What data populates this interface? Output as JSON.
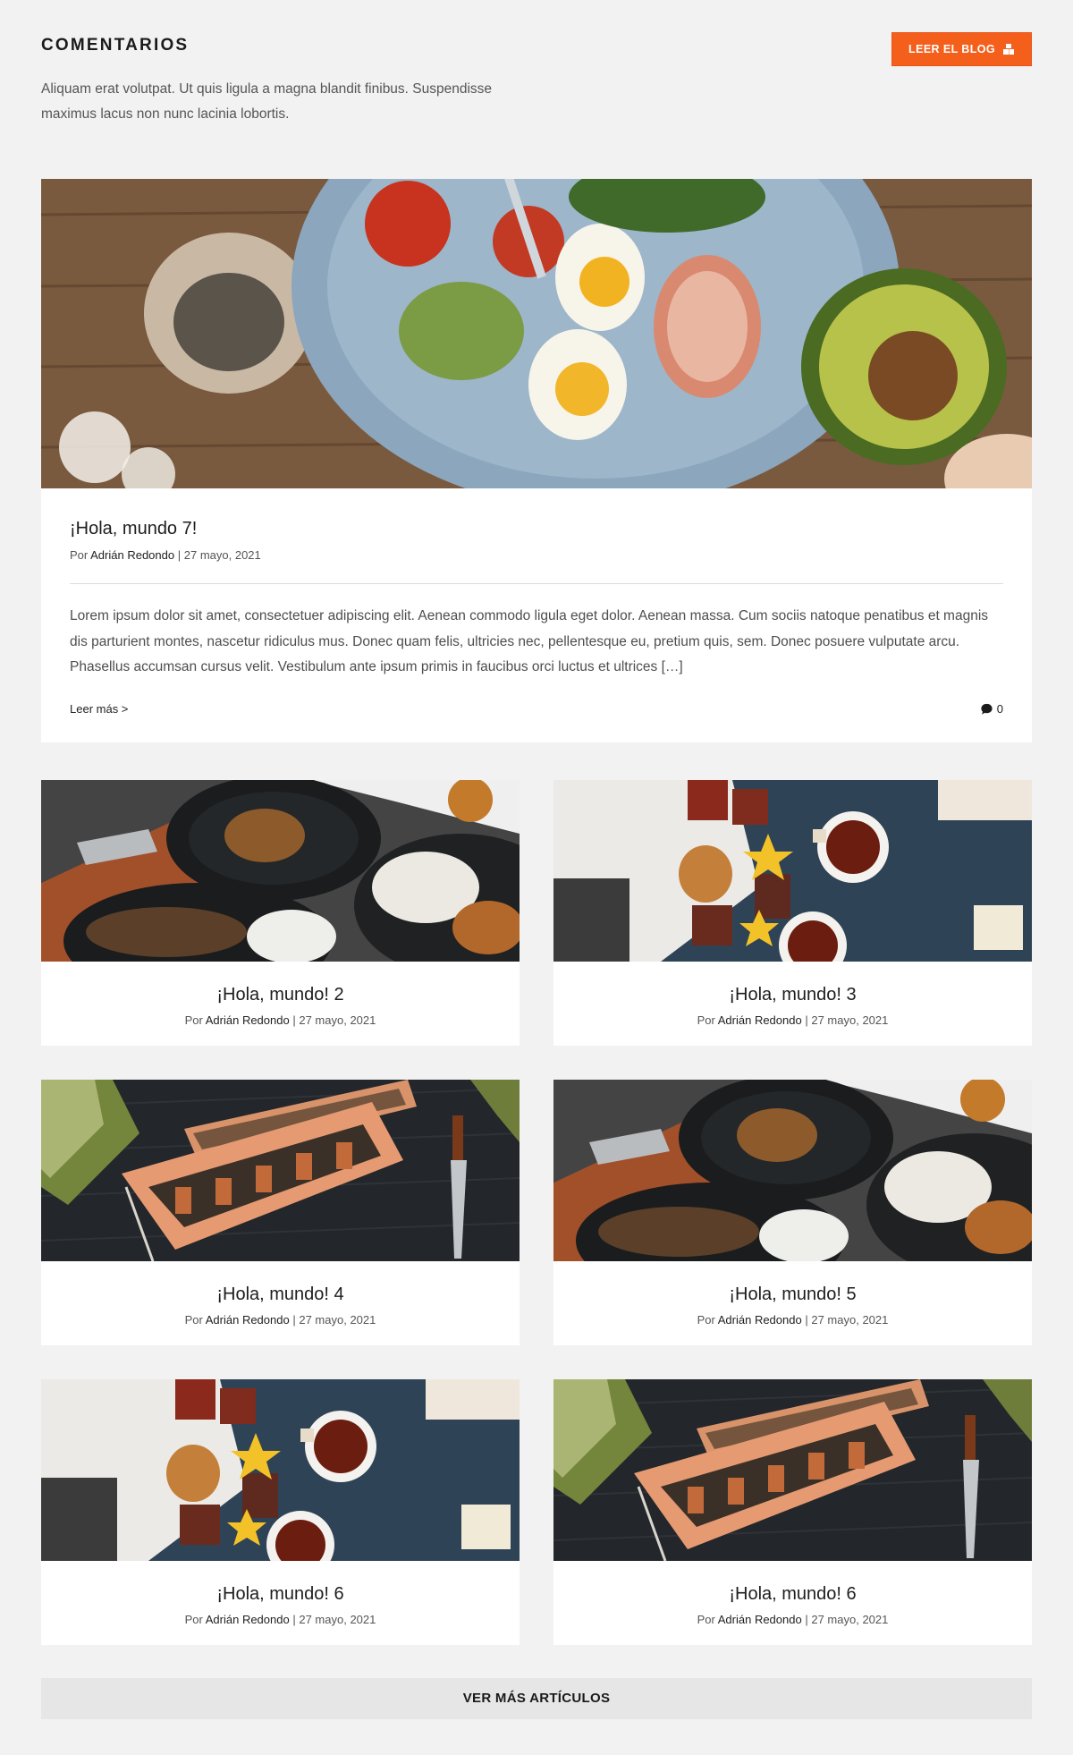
{
  "header": {
    "title": "COMENTARIOS",
    "description": "Aliquam erat volutpat. Ut quis ligula a magna blandit finibus. Suspendisse maximus lacus non nunc lacinia lobortis.",
    "blog_button_label": "LEER EL BLOG",
    "blog_button_icon": "box-stack-icon",
    "accent_color": "#f4601c"
  },
  "featured": {
    "title": "¡Hola, mundo 7!",
    "meta_prefix": "Por",
    "author": "Adrián Redondo",
    "separator": "|",
    "date": "27 mayo, 2021",
    "excerpt": "Lorem ipsum dolor sit amet, consectetuer adipiscing elit. Aenean commodo ligula eget dolor. Aenean massa. Cum sociis natoque penatibus et magnis dis parturient montes, nascetur ridiculus mus. Donec quam felis, ultricies nec, pellentesque eu, pretium quis, sem. Donec posuere vulputate arcu. Phasellus accumsan cursus velit. Vestibulum ante ipsum primis in faucibus orci luctus et ultrices […]",
    "read_more": "Leer más >",
    "comment_count": "0",
    "image": "salad-bowl-photo"
  },
  "posts": [
    {
      "title": "¡Hola, mundo! 2",
      "meta_prefix": "Por",
      "author": "Adrián Redondo",
      "separator": "|",
      "date": "27 mayo, 2021",
      "image": "fish-plates-photo"
    },
    {
      "title": "¡Hola, mundo! 3",
      "meta_prefix": "Por",
      "author": "Adrián Redondo",
      "separator": "|",
      "date": "27 mayo, 2021",
      "image": "tea-toast-photo"
    },
    {
      "title": "¡Hola, mundo! 4",
      "meta_prefix": "Por",
      "author": "Adrián Redondo",
      "separator": "|",
      "date": "27 mayo, 2021",
      "image": "sushi-board-photo"
    },
    {
      "title": "¡Hola, mundo! 5",
      "meta_prefix": "Por",
      "author": "Adrián Redondo",
      "separator": "|",
      "date": "27 mayo, 2021",
      "image": "fish-plates-photo"
    },
    {
      "title": "¡Hola, mundo! 6",
      "meta_prefix": "Por",
      "author": "Adrián Redondo",
      "separator": "|",
      "date": "27 mayo, 2021",
      "image": "tea-toast-photo"
    },
    {
      "title": "¡Hola, mundo! 6",
      "meta_prefix": "Por",
      "author": "Adrián Redondo",
      "separator": "|",
      "date": "27 mayo, 2021",
      "image": "sushi-board-photo"
    }
  ],
  "more_button_label": "VER MÁS ARTÍCULOS"
}
